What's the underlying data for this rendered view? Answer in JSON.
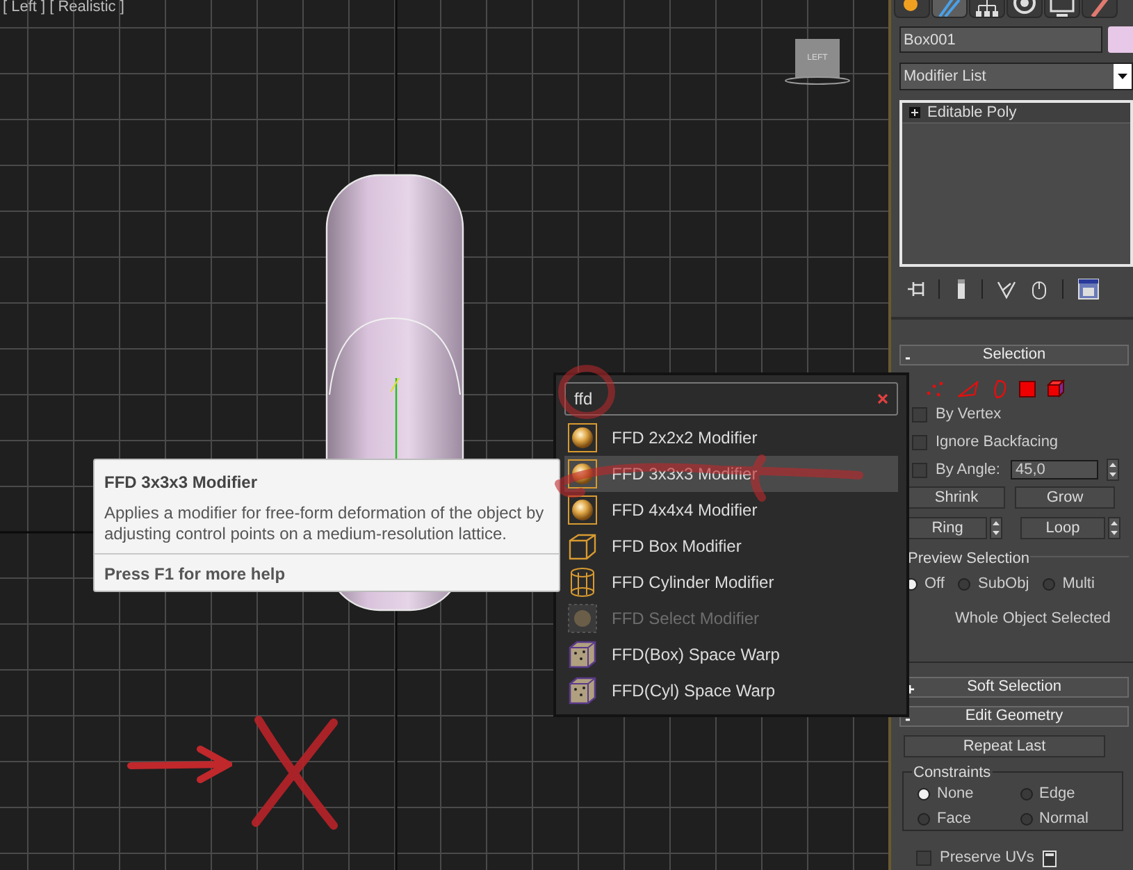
{
  "viewport": {
    "label": "[ Left ] [ Realistic ]",
    "viewcube_label": "LEFT"
  },
  "command_panel": {
    "tabs": [
      {
        "kind": "create",
        "selected": false
      },
      {
        "kind": "modify",
        "selected": true
      },
      {
        "kind": "hierarchy",
        "selected": false
      },
      {
        "kind": "motion",
        "selected": false
      },
      {
        "kind": "display",
        "selected": false
      },
      {
        "kind": "utilities",
        "selected": false
      }
    ],
    "object_name": "Box001",
    "modifier_list": "Modifier List",
    "stack": [
      {
        "label": "Editable Poly"
      }
    ],
    "selection": {
      "toggle": "-",
      "title": "Selection",
      "checkboxes": [
        {
          "label": "By Vertex",
          "checked": false
        },
        {
          "label": "Ignore Backfacing",
          "checked": false
        },
        {
          "label": "By Angle:",
          "checked": false
        }
      ],
      "angle_value": "45,0",
      "shrink": "Shrink",
      "grow": "Grow",
      "ring": "Ring",
      "loop": "Loop",
      "preview": {
        "title": "Preview Selection",
        "options": [
          {
            "label": "Off",
            "selected": true
          },
          {
            "label": "SubObj",
            "selected": false
          },
          {
            "label": "Multi",
            "selected": false
          }
        ]
      },
      "status": "Whole Object Selected"
    },
    "soft_selection": {
      "toggle": "+",
      "title": "Soft Selection"
    },
    "edit_geometry": {
      "toggle": "-",
      "title": "Edit Geometry",
      "repeat": "Repeat Last",
      "constraints": {
        "title": "Constraints",
        "options": [
          {
            "label": "None",
            "selected": true
          },
          {
            "label": "Edge",
            "selected": false
          },
          {
            "label": "Face",
            "selected": false
          },
          {
            "label": "Normal",
            "selected": false
          }
        ]
      },
      "preserve_uvs": {
        "label": "Preserve UVs",
        "checked": false
      }
    }
  },
  "search_popup": {
    "query": "ffd",
    "items": [
      {
        "label": "FFD 2x2x2 Modifier",
        "kind": "sphere",
        "selected": false,
        "disabled": false
      },
      {
        "label": "FFD 3x3x3 Modifier",
        "kind": "sphere",
        "selected": true,
        "disabled": false
      },
      {
        "label": "FFD 4x4x4 Modifier",
        "kind": "sphere",
        "selected": false,
        "disabled": false
      },
      {
        "label": "FFD Box Modifier",
        "kind": "box",
        "selected": false,
        "disabled": false
      },
      {
        "label": "FFD Cylinder Modifier",
        "kind": "cylinder",
        "selected": false,
        "disabled": false
      },
      {
        "label": "FFD Select Modifier",
        "kind": "select",
        "selected": false,
        "disabled": true
      },
      {
        "label": "FFD(Box) Space Warp",
        "kind": "warp",
        "selected": false,
        "disabled": false
      },
      {
        "label": "FFD(Cyl) Space Warp",
        "kind": "warp",
        "selected": false,
        "disabled": false
      }
    ]
  },
  "tooltip": {
    "title": "FFD 3x3x3 Modifier",
    "description": "Applies a modifier for free-form deformation of the object by adjusting control points on a medium-resolution lattice.",
    "help": "Press F1 for more help"
  }
}
